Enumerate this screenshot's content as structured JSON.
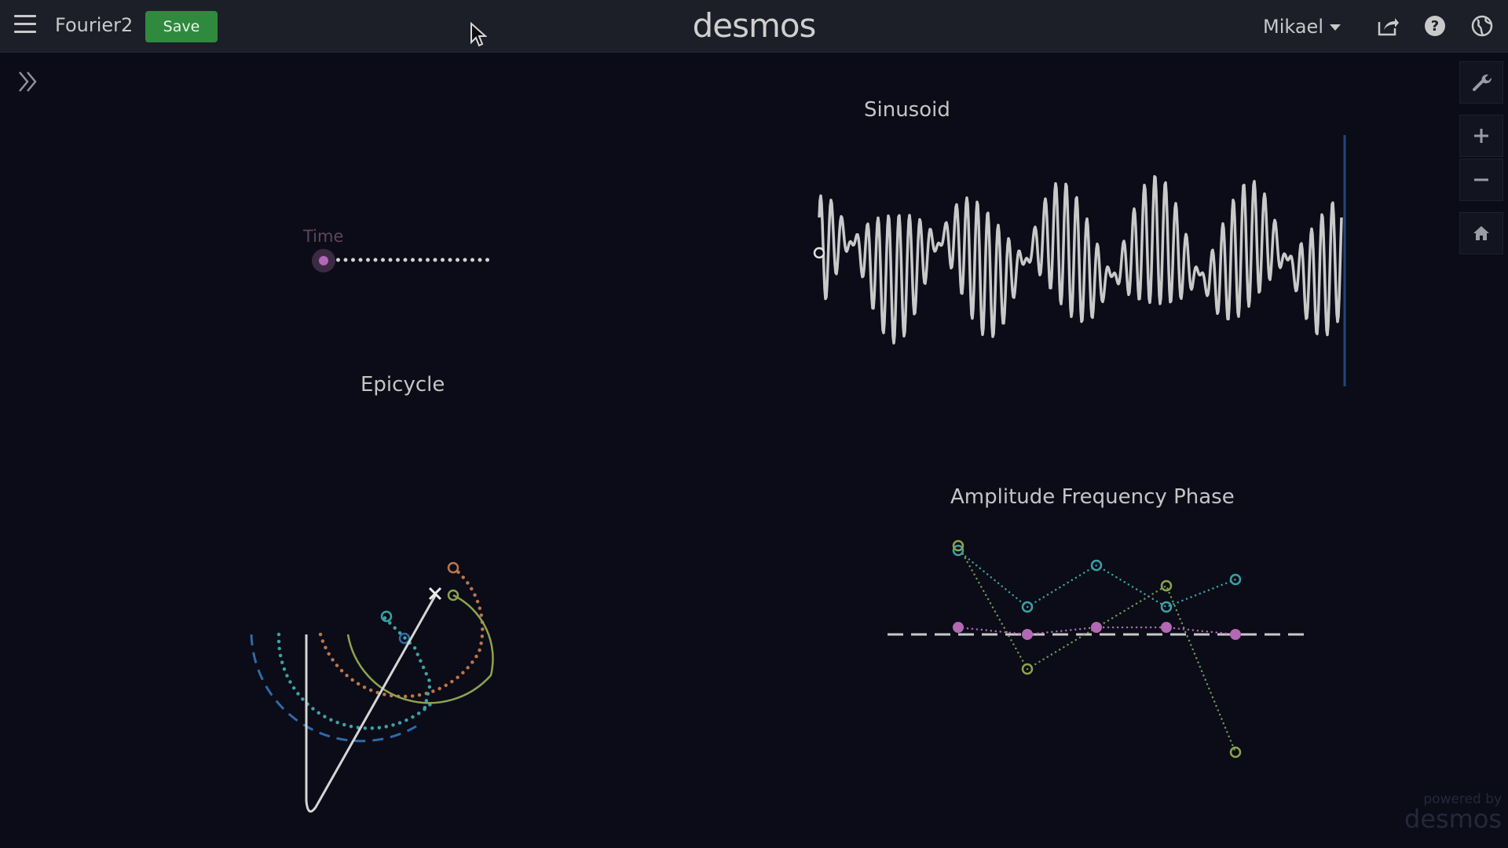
{
  "header": {
    "graph_title": "Fourier2",
    "save_label": "Save",
    "logo": "desmos",
    "user_name": "Mikael"
  },
  "graph": {
    "slider_label": "Time",
    "labels": {
      "sinusoid": "Sinusoid",
      "epicycle": "Epicycle",
      "afp": "Amplitude Frequency Phase"
    },
    "watermark_top": "powered by",
    "watermark_bottom": "desmos"
  },
  "icons": {
    "menu": "menu-icon",
    "share": "share-icon",
    "help": "help-icon",
    "language": "globe-icon",
    "expand": "double-chevron-icon",
    "settings": "wrench-icon",
    "zoom_in": "plus-icon",
    "zoom_out": "minus-icon",
    "home": "home-icon"
  },
  "colors": {
    "background": "#0b0c17",
    "header": "#1c1e28",
    "save_button": "#2f8a3e",
    "curve": "#c9c9c9",
    "magenta": "#b368b4",
    "teal": "#3ba1a6",
    "olive": "#8fa24e",
    "orange": "#b9764d",
    "blue": "#2f6aa8"
  }
}
